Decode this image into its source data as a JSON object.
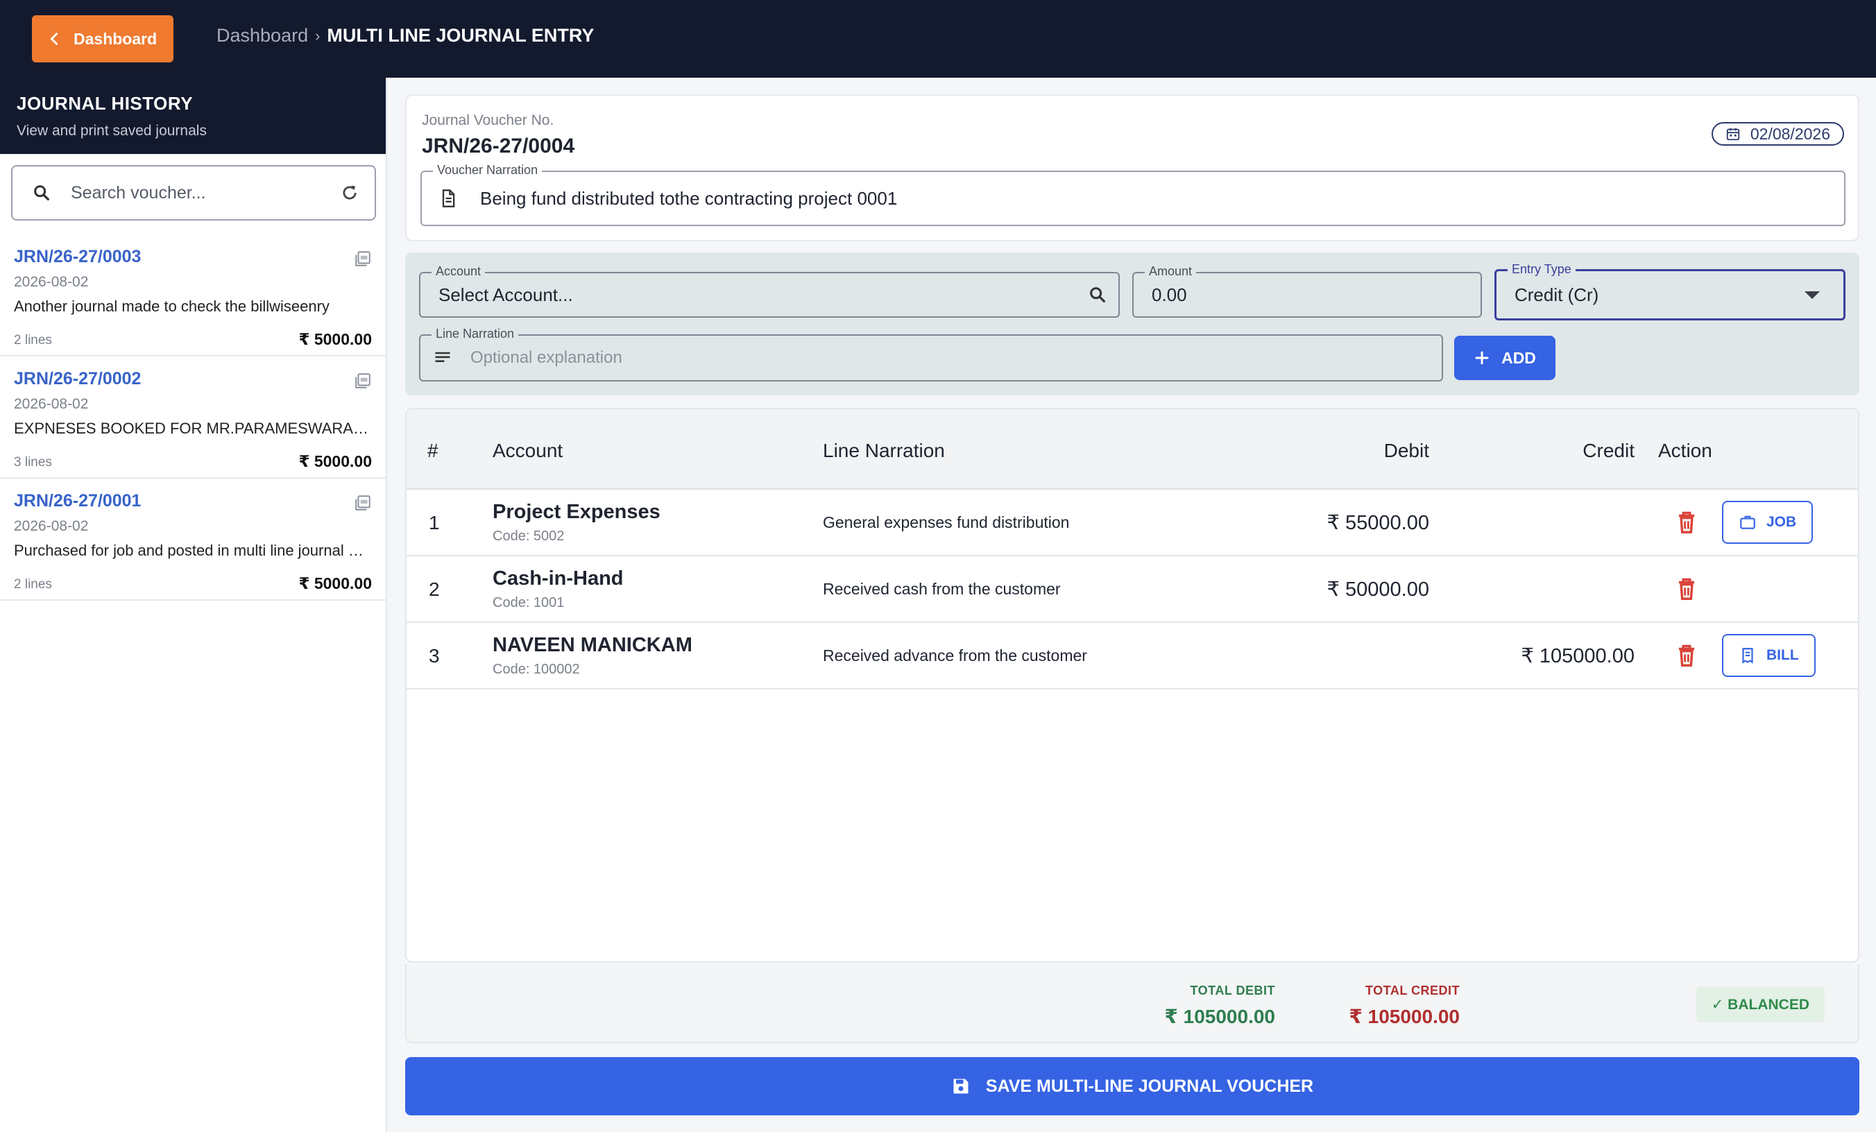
{
  "header": {
    "back_label": "Dashboard",
    "breadcrumb_root": "Dashboard",
    "breadcrumb_sep": "›",
    "breadcrumb_current": "MULTI LINE JOURNAL ENTRY"
  },
  "sidebar": {
    "title": "JOURNAL HISTORY",
    "subtitle": "View and print saved journals",
    "search_placeholder": "Search voucher...",
    "items": [
      {
        "voucher": "JRN/26-27/0003",
        "date": "2026-08-02",
        "narration": "Another journal made to check the billwiseenry",
        "lines": "2 lines",
        "amount": "₹ 5000.00"
      },
      {
        "voucher": "JRN/26-27/0002",
        "date": "2026-08-02",
        "narration": "EXPNESES BOOKED FOR MR.PARAMESWARAN AND TEAM",
        "lines": "3 lines",
        "amount": "₹ 5000.00"
      },
      {
        "voucher": "JRN/26-27/0001",
        "date": "2026-08-02",
        "narration": "Purchased for job and posted in multi line journal entry",
        "lines": "2 lines",
        "amount": "₹ 5000.00"
      }
    ]
  },
  "voucher": {
    "label": "Journal Voucher No.",
    "number": "JRN/26-27/0004",
    "date": "02/08/2026",
    "narration_label": "Voucher Narration",
    "narration": "Being fund distributed tothe contracting project 0001"
  },
  "entry_form": {
    "account_label": "Account",
    "account_value": "Select Account...",
    "amount_label": "Amount",
    "amount_value": "0.00",
    "type_label": "Entry Type",
    "type_value": "Credit (Cr)",
    "line_narration_label": "Line Narration",
    "line_narration_placeholder": "Optional explanation",
    "add_label": "ADD"
  },
  "table": {
    "headers": {
      "num": "#",
      "account": "Account",
      "narration": "Line Narration",
      "debit": "Debit",
      "credit": "Credit",
      "action": "Action"
    },
    "rows": [
      {
        "num": "1",
        "account": "Project Expenses",
        "code": "Code: 5002",
        "narration": "General expenses fund distribution",
        "debit": "₹ 55000.00",
        "credit": "",
        "tag": "JOB"
      },
      {
        "num": "2",
        "account": "Cash-in-Hand",
        "code": "Code: 1001",
        "narration": "Received cash from the customer",
        "debit": "₹ 50000.00",
        "credit": "",
        "tag": ""
      },
      {
        "num": "3",
        "account": "NAVEEN MANICKAM",
        "code": "Code: 100002",
        "narration": "Received advance from the customer",
        "debit": "",
        "credit": "₹ 105000.00",
        "tag": "BILL"
      }
    ]
  },
  "totals": {
    "debit_label": "TOTAL DEBIT",
    "debit_value": "₹ 105000.00",
    "credit_label": "TOTAL CREDIT",
    "credit_value": "₹ 105000.00",
    "status": "✓ BALANCED"
  },
  "save_label": "SAVE MULTI-LINE JOURNAL VOUCHER",
  "colors": {
    "topbar": "#131a2e",
    "accent_orange": "#ef7a30",
    "primary_blue": "#3563e4",
    "delete_red": "#d9443a",
    "debit_green": "#2f7d4f",
    "credit_red": "#b02f2f"
  }
}
